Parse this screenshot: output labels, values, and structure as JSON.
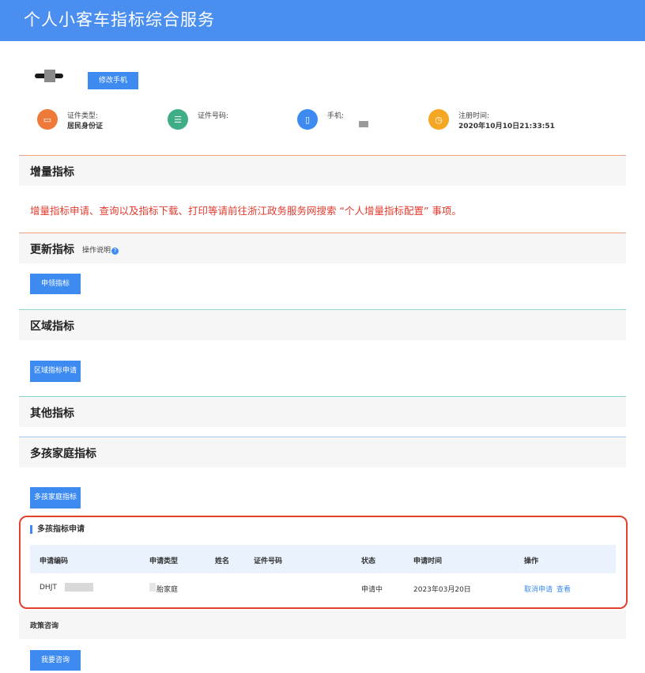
{
  "header": {
    "title": "个人小客车指标综合服务"
  },
  "profile": {
    "modify_phone_label": "修改手机",
    "info": [
      {
        "label": "证件类型:",
        "value": "居民身份证",
        "icon": "id-card-icon",
        "color": "#ee7a3a"
      },
      {
        "label": "证件号码:",
        "value": "",
        "icon": "id-number-icon",
        "color": "#3fae85"
      },
      {
        "label": "手机:",
        "value": "",
        "icon": "phone-icon",
        "color": "#3d8bf0"
      },
      {
        "label": "注册时间:",
        "value": "2020年10月10日21:33:51",
        "icon": "clock-icon",
        "color": "#f5a623"
      }
    ]
  },
  "sections": {
    "increment": {
      "title": "增量指标",
      "notice": "增量指标申请、查询以及指标下载、打印等请前往浙江政务服务网搜索 “个人增量指标配置” 事项。"
    },
    "renewal": {
      "title": "更新指标",
      "help_label": "操作说明",
      "button": "申领指标"
    },
    "regional": {
      "title": "区域指标",
      "button": "区域指标申请"
    },
    "other": {
      "title": "其他指标"
    },
    "multi_child": {
      "title": "多孩家庭指标",
      "button": "多孩家庭指标"
    }
  },
  "application": {
    "title": "多孩指标申请",
    "columns": [
      "申请编码",
      "申请类型",
      "姓名",
      "证件号码",
      "状态",
      "申请时间",
      "操作"
    ],
    "row": {
      "code": "DHJT",
      "type": "胎家庭",
      "name": "",
      "id_no": "",
      "status": "申请中",
      "date": "2023年03月20日",
      "action_cancel": "取消申请",
      "action_view": "查看"
    }
  },
  "consult": {
    "title": "政策咨询",
    "button": "我要咨询"
  },
  "colors": {
    "primary": "#3d8bf0",
    "header": "#4a8ff0",
    "alert": "#e23b2e",
    "orange_line": "#f2a27c",
    "teal_line": "#8fd6cc",
    "blue_line": "#a9c6f0"
  }
}
